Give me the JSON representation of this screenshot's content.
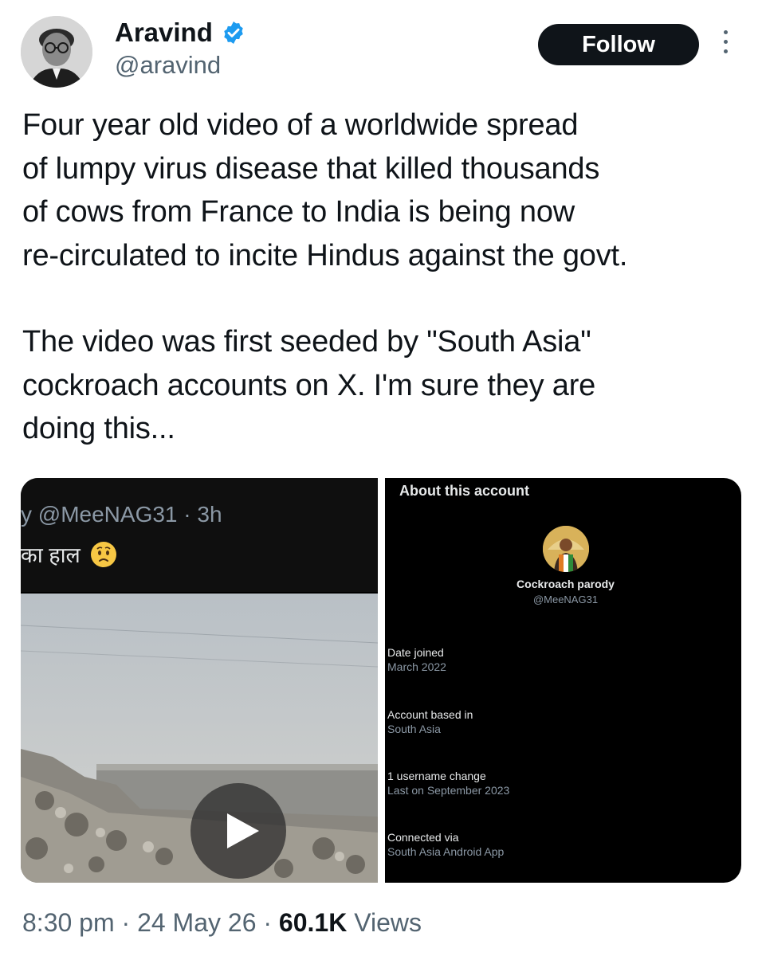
{
  "author": {
    "name": "Aravind",
    "handle": "@aravind",
    "verified": true,
    "follow_label": "Follow"
  },
  "tweet": {
    "lines_para1": [
      "Four year old video of a worldwide spread",
      "of lumpy virus disease that killed thousands",
      "of cows from France to India is being now",
      "re-circulated to incite Hindus against the govt."
    ],
    "lines_para2": [
      "The video was first seeded by \"South Asia\"",
      "cockroach accounts on X. I'm sure they are",
      "doing this..."
    ]
  },
  "media_left": {
    "handle_line": "y @MeeNAG31 · 3h",
    "hindi_text": "का हाल"
  },
  "media_right": {
    "title": "About this account",
    "profile_name": "Cockroach parody",
    "profile_handle": "@MeeNAG31",
    "details": [
      {
        "label": "Date joined",
        "value": "March 2022"
      },
      {
        "label": "Account based in",
        "value": "South Asia"
      },
      {
        "label": "1 username change",
        "value": "Last on September 2023"
      },
      {
        "label": "Connected via",
        "value": "South Asia Android App"
      }
    ]
  },
  "footer": {
    "time": "8:30 pm",
    "sep1": " · ",
    "date": "24 May 26",
    "sep2": " · ",
    "views_count": "60.1K",
    "views_label": " Views"
  },
  "colors": {
    "primary_text": "#0f1419",
    "secondary_text": "#536471",
    "verified_blue": "#1d9bf0",
    "follow_bg": "#0f1419"
  },
  "icons": [
    "verified-badge-icon",
    "more-options-icon",
    "worried-face-emoji",
    "play-icon"
  ]
}
